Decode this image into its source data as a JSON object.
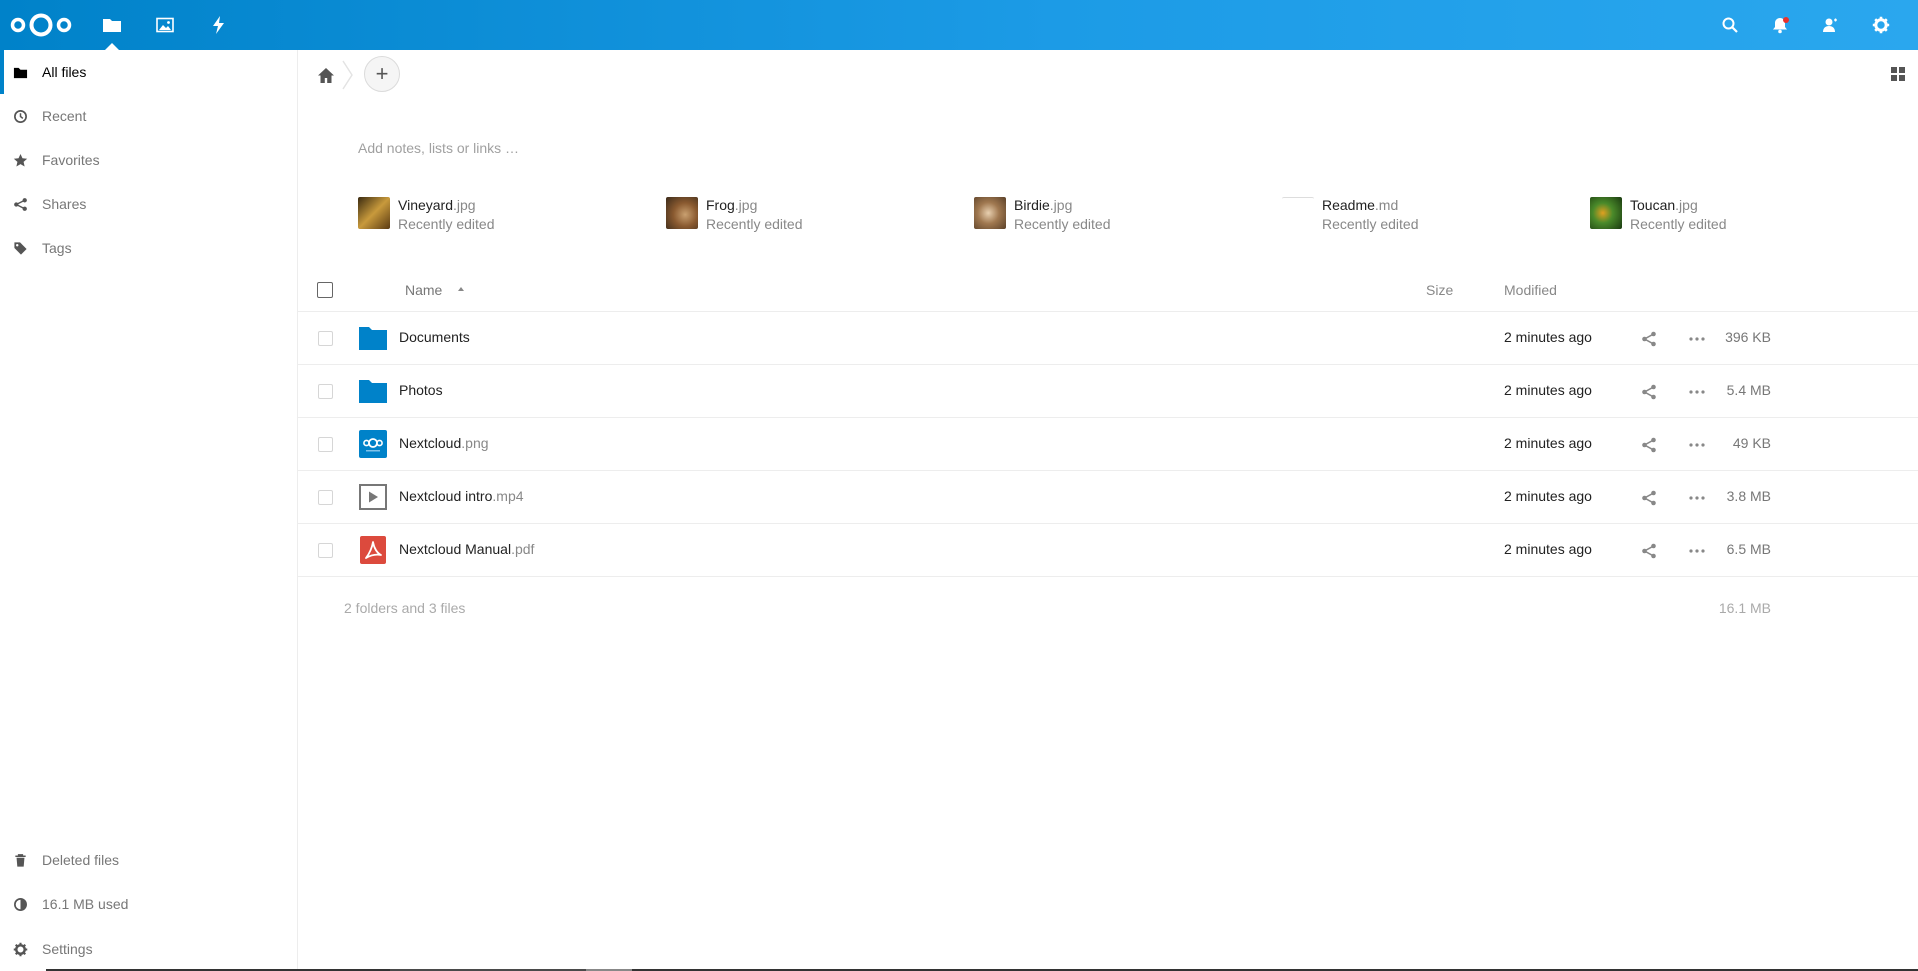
{
  "header": {
    "apps": [
      {
        "name": "files",
        "active": true
      },
      {
        "name": "photos",
        "active": false
      },
      {
        "name": "activity",
        "active": false
      }
    ],
    "right_icons": [
      "search",
      "notifications",
      "contacts",
      "settings"
    ],
    "brand_color": "#0082c9"
  },
  "sidebar": {
    "items": [
      {
        "label": "All files",
        "icon": "folder-icon",
        "active": true
      },
      {
        "label": "Recent",
        "icon": "clock-icon",
        "active": false
      },
      {
        "label": "Favorites",
        "icon": "star-icon",
        "active": false
      },
      {
        "label": "Shares",
        "icon": "share-icon",
        "active": false
      },
      {
        "label": "Tags",
        "icon": "tag-icon",
        "active": false
      }
    ],
    "bottom": {
      "deleted": "Deleted files",
      "quota": "16.1 MB used",
      "settings": "Settings"
    }
  },
  "main": {
    "notes_placeholder": "Add notes, lists or links …",
    "add_label": "+",
    "recent": [
      {
        "base": "Vineyard",
        "ext": ".jpg",
        "sub": "Recently edited",
        "thumb_colors": [
          "#3a2a10",
          "#c89a3c"
        ]
      },
      {
        "base": "Frog",
        "ext": ".jpg",
        "sub": "Recently edited",
        "thumb_colors": [
          "#6b4a2a",
          "#c9a070"
        ]
      },
      {
        "base": "Birdie",
        "ext": ".jpg",
        "sub": "Recently edited",
        "thumb_colors": [
          "#8a6a4a",
          "#d8b890"
        ]
      },
      {
        "base": "Readme",
        "ext": ".md",
        "sub": "Recently edited",
        "thumb_colors": [
          "#ffffff",
          "#f4f4f4"
        ]
      },
      {
        "base": "Toucan",
        "ext": ".jpg",
        "sub": "Recently edited",
        "thumb_colors": [
          "#2d5a1a",
          "#7fb040"
        ]
      }
    ],
    "columns": {
      "name": "Name",
      "size": "Size",
      "modified": "Modified"
    },
    "files": [
      {
        "base": "Documents",
        "ext": "",
        "type": "folder",
        "size": "396 KB",
        "modified": "2 minutes ago"
      },
      {
        "base": "Photos",
        "ext": "",
        "type": "folder",
        "size": "5.4 MB",
        "modified": "2 minutes ago"
      },
      {
        "base": "Nextcloud",
        "ext": ".png",
        "type": "image",
        "size": "49 KB",
        "modified": "2 minutes ago"
      },
      {
        "base": "Nextcloud intro",
        "ext": ".mp4",
        "type": "video",
        "size": "3.8 MB",
        "modified": "2 minutes ago"
      },
      {
        "base": "Nextcloud Manual",
        "ext": ".pdf",
        "type": "pdf",
        "size": "6.5 MB",
        "modified": "2 minutes ago"
      }
    ],
    "summary": {
      "text": "2 folders and 3 files",
      "size": "16.1 MB"
    }
  }
}
